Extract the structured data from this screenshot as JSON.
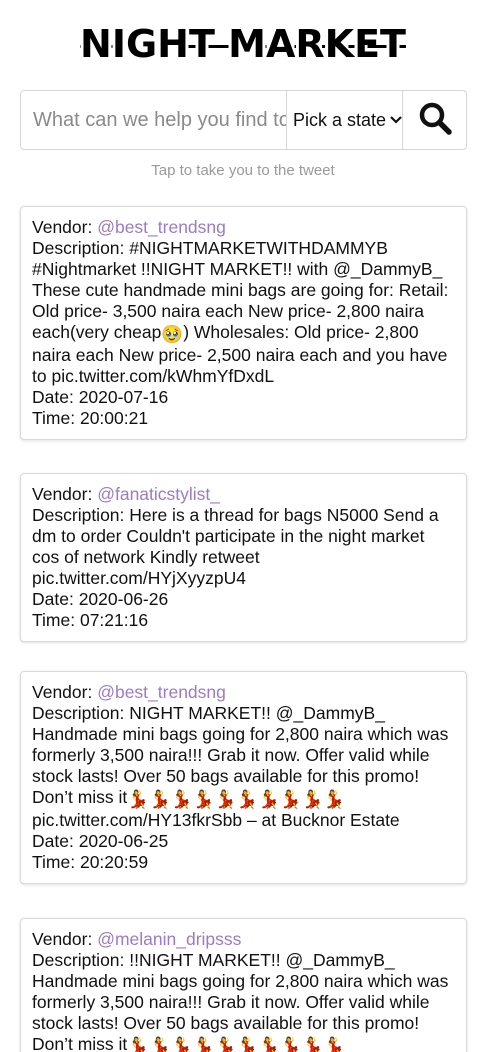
{
  "header": {
    "title": "NIGHT MARKET"
  },
  "search": {
    "placeholder": "What can we help you find today?",
    "state_label": "Pick a state",
    "hint": "Tap to take you to the tweet"
  },
  "labels": {
    "vendor": "Vendor: ",
    "description": "Description: ",
    "date": "Date: ",
    "time": "Time: "
  },
  "colors": {
    "vendor_link": "#9b7bc7",
    "card_border": "#d9d9d9"
  },
  "posts": [
    {
      "vendor": "@best_trendsng",
      "description_a": "#NIGHTMARKETWITHDAMMYB #Nightmarket !!NIGHT MARKET!! with @_DammyB_ These cute handmade mini bags are going for: Retail: Old price- 3,500 naira each New price- 2,800 naira each(very cheap",
      "emoji": "🥹",
      "description_b": ") Wholesales: Old price- 2,800 naira each New price- 2,500 naira each and you have to pic.twitter.com/kWhmYfDxdL",
      "date": "2020-07-16",
      "time": "20:00:21"
    },
    {
      "vendor": "@fanaticstylist_",
      "description_a": "Here is a thread for bags N5000 Send a dm to order Couldn't participate in the night market cos of network Kindly retweet pic.twitter.com/HYjXyyzpU4",
      "date": "2020-06-26",
      "time": "07:21:16"
    },
    {
      "vendor": "@best_trendsng",
      "description_a": "NIGHT MARKET!! @_DammyB_ Handmade mini bags going for 2,800 naira which was formerly 3,500 naira!!! Grab it now. Offer valid while stock lasts! Over 50 bags available for this promo! Don’t miss it",
      "emoji": "💃💃💃💃💃💃💃💃💃💃",
      "description_b": " pic.twitter.com/HY13fkrSbb – at Bucknor Estate",
      "date": "2020-06-25",
      "time": "20:20:59"
    },
    {
      "vendor": "@melanin_dripsss",
      "description_a": "!!NIGHT MARKET!! @_DammyB_ Handmade mini bags going for 2,800 naira which was formerly 3,500 naira!!! Grab it now. Offer valid while stock lasts! Over 50 bags available for this promo! Don’t miss it",
      "emoji": "💃💃💃💃💃💃💃💃💃💃"
    }
  ]
}
